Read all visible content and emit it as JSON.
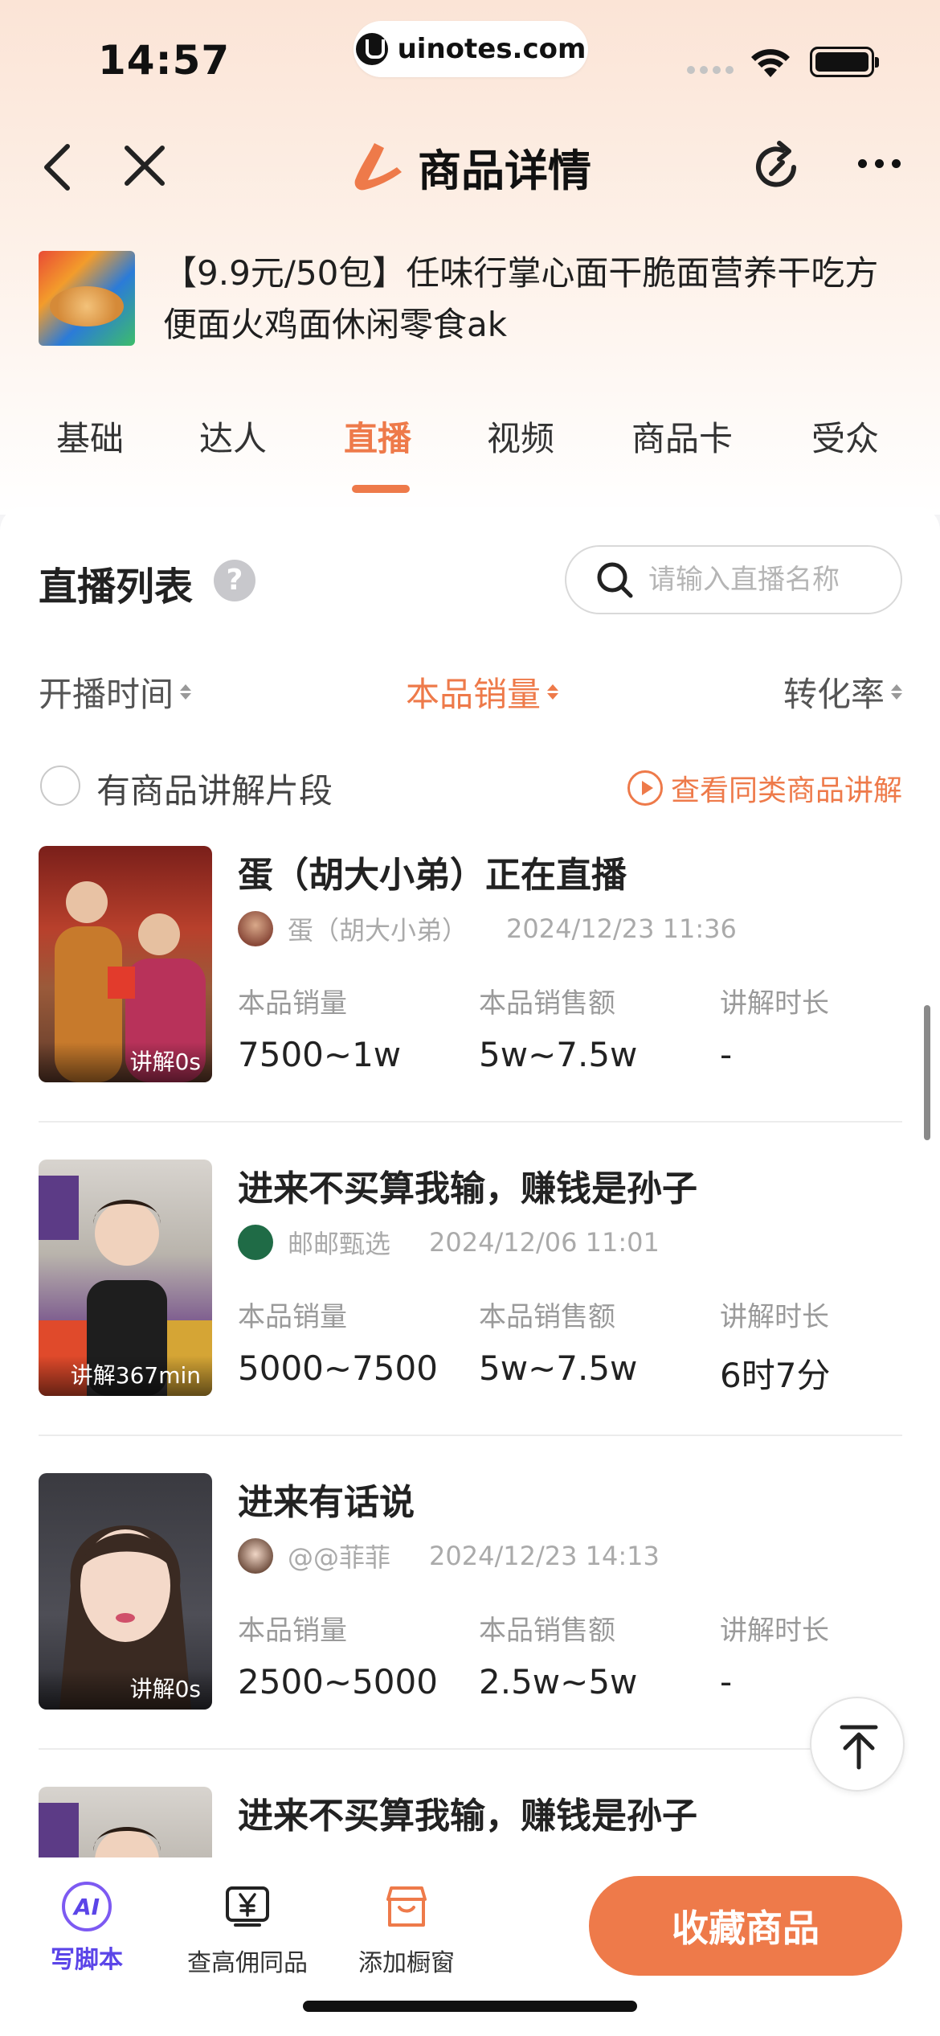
{
  "status": {
    "time": "14:57",
    "url": "uinotes.com"
  },
  "nav": {
    "title": "商品详情"
  },
  "product": {
    "name": "【9.9元/50包】任味行掌心面干脆面营养干吃方便面火鸡面休闲零食ak"
  },
  "tabs": [
    {
      "label": "基础"
    },
    {
      "label": "达人"
    },
    {
      "label": "直播",
      "active": true
    },
    {
      "label": "视频"
    },
    {
      "label": "商品卡"
    },
    {
      "label": "受众"
    }
  ],
  "section": {
    "title": "直播列表",
    "help": "?",
    "search_placeholder": "请输入直播名称"
  },
  "sort": {
    "start_time": "开播时间",
    "sales": "本品销量",
    "conversion": "转化率",
    "active": "sales"
  },
  "filter": {
    "checkbox_label": "有商品讲解片段",
    "similar_link": "查看同类商品讲解"
  },
  "stat_labels": {
    "sales": "本品销量",
    "revenue": "本品销售额",
    "duration": "讲解时长"
  },
  "lives": [
    {
      "title": "蛋（胡大小弟）正在直播",
      "anchor": "蛋（胡大小弟）",
      "date": "2024/12/23 11:36",
      "tag": "讲解0s",
      "sales": "7500~1w",
      "revenue": "5w~7.5w",
      "duration": "-"
    },
    {
      "title": "进来不买算我输，赚钱是孙子",
      "anchor": "邮邮甄选",
      "date": "2024/12/06 11:01",
      "tag": "讲解367min",
      "sales": "5000~7500",
      "revenue": "5w~7.5w",
      "duration": "6时7分"
    },
    {
      "title": "进来有话说",
      "anchor": "@@菲菲",
      "date": "2024/12/23 14:13",
      "tag": "讲解0s",
      "sales": "2500~5000",
      "revenue": "2.5w~5w",
      "duration": "-"
    },
    {
      "title": "进来不买算我输，赚钱是孙子"
    }
  ],
  "bottom": {
    "ai_label": "写脚本",
    "ai_badge": "AI",
    "high_comm_label": "查高佣同品",
    "add_window_label": "添加橱窗",
    "favorite_button": "收藏商品"
  },
  "colors": {
    "accent": "#ee7a4a",
    "ai": "#5b45e8"
  }
}
